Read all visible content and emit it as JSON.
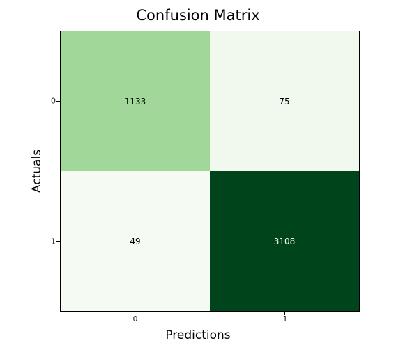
{
  "chart_data": {
    "type": "heatmap",
    "title": "Confusion Matrix",
    "xlabel": "Predictions",
    "ylabel": "Actuals",
    "x_categories": [
      "0",
      "1"
    ],
    "y_categories": [
      "0",
      "1"
    ],
    "values": [
      [
        1133,
        75
      ],
      [
        49,
        3108
      ]
    ],
    "cell_colors": [
      [
        "#a2d79a",
        "#f1f9ef"
      ],
      [
        "#f5fbf3",
        "#00441b"
      ]
    ],
    "cell_text_dark": [
      [
        false,
        false
      ],
      [
        false,
        true
      ]
    ]
  }
}
